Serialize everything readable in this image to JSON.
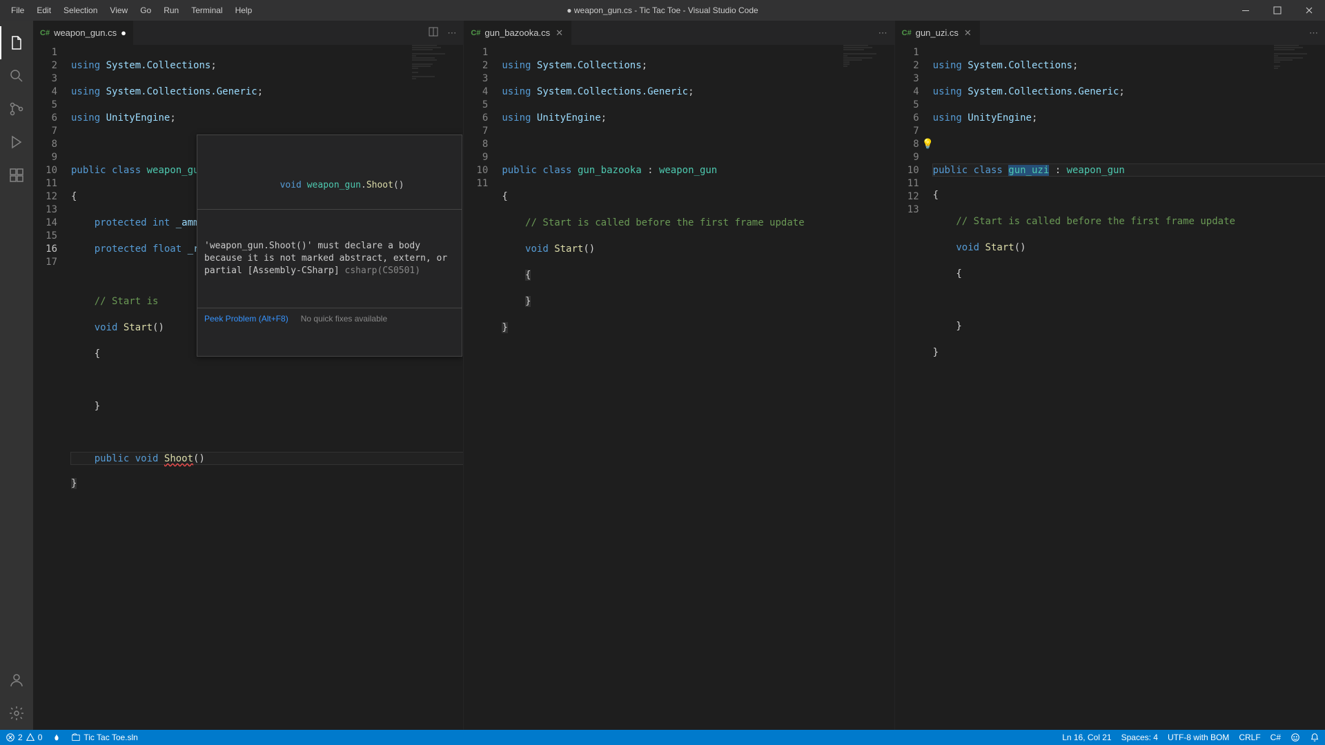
{
  "app": {
    "title": "● weapon_gun.cs - Tic Tac Toe - Visual Studio Code"
  },
  "menu": {
    "file": "File",
    "edit": "Edit",
    "selection": "Selection",
    "view": "View",
    "go": "Go",
    "run": "Run",
    "terminal": "Terminal",
    "help": "Help"
  },
  "tabs": {
    "p1": {
      "name": "weapon_gun.cs",
      "dirty": true
    },
    "p2": {
      "name": "gun_bazooka.cs"
    },
    "p3": {
      "name": "gun_uzi.cs"
    }
  },
  "hover": {
    "sig_prefix": "void",
    "sig_cls": "weapon_gun",
    "sig_mth": "Shoot",
    "err_msg": "'weapon_gun.Shoot()' must declare a body because it is not marked abstract, extern, or partial [Assembly-CSharp]",
    "err_code": "csharp(CS0501)",
    "peek": "Peek Problem (Alt+F8)",
    "nofix": "No quick fixes available"
  },
  "pane1": {
    "comment_frag": "// Start is",
    "lines": 17
  },
  "pane2": {
    "comment": "// Start is called before the first frame update",
    "lines": 11
  },
  "pane3": {
    "comment": "// Start is called before the first frame update",
    "lines": 13
  },
  "code_common": {
    "using1": "System.Collections",
    "using2": "System.Collections.Generic",
    "using3": "UnityEngine",
    "start": "Start"
  },
  "status": {
    "errors": "2",
    "warnings": "0",
    "project": "Tic Tac Toe.sln",
    "cursor": "Ln 16, Col 21",
    "spaces": "Spaces: 4",
    "encoding": "UTF-8 with BOM",
    "eol": "CRLF",
    "lang": "C#"
  },
  "chart_data": null
}
